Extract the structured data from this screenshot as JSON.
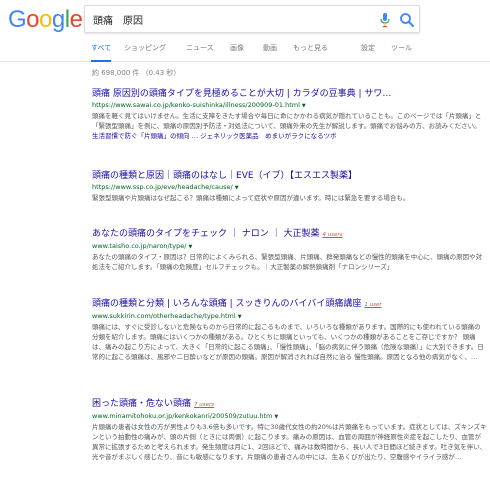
{
  "logo": {
    "text": "Google",
    "letters": [
      {
        "ch": "G",
        "color": "#4285F4"
      },
      {
        "ch": "o",
        "color": "#EA4335"
      },
      {
        "ch": "o",
        "color": "#FBBC05"
      },
      {
        "ch": "g",
        "color": "#4285F4"
      },
      {
        "ch": "l",
        "color": "#34A853"
      },
      {
        "ch": "e",
        "color": "#EA4335"
      }
    ]
  },
  "search": {
    "query": "頭痛　原因",
    "mic_icon": "mic-icon",
    "search_icon": "search-icon"
  },
  "tabs": [
    {
      "label": "すべて"
    },
    {
      "label": "ショッピング"
    },
    {
      "label": "ニュース"
    },
    {
      "label": "画像"
    },
    {
      "label": "動画"
    },
    {
      "label": "もっと見る"
    },
    {
      "label": "設定"
    },
    {
      "label": "ツール"
    }
  ],
  "stats": "約 698,000 件 （0.43 秒）",
  "results": [
    {
      "title": "頭痛 原因別の頭痛タイプを見極めることが大切 | カラダの豆事典 | サワ…",
      "url": "https://www.sawai.co.jp/kenko-suishinka/illness/200909-01.html",
      "users": "",
      "snippet": "頭痛を軽く見てはいけません。生活に支障をきたす場合や毎日に命にかかわる病気が隠れていることも。このページでは「片頭痛」と「緊張型頭痛」を例に、頭痛の原因別予防法・対処法について、頭痛外来の先生が解説します。頭痛でお悩みの方、お読みください。",
      "sublinks": "生活習慣で防ぐ「片頭痛」の傾向 … ジェネリック医薬品　めまいがラクになるツボ"
    },
    {
      "title": "頭痛の種類と原因｜頭痛のはなし｜EVE（イブ）【エスエス製薬】",
      "url": "https://www.ssp.co.jp/eve/headache/cause/",
      "users": "",
      "snippet": "緊張型頭痛や片頭痛はなぜ起こる？頭痛は種類によって症状や原因が違います。時には緊急を要する場合も。",
      "sublinks": ""
    },
    {
      "title": "あなたの頭痛のタイプをチェック ｜ ナロン ｜ 大正製薬",
      "url": "www.taisho.co.jp/naron/type/",
      "users": "4 users",
      "snippet": "あなたの頭痛のタイプ・原因は？日常的によくみられる、緊張型頭痛、片頭痛、群発頭痛などの慢性的頭痛を中心に、頭痛の原因や対処法をご紹介します。「頭痛の危険度」セルフチェックも。｜大正製薬の解熱鎮痛剤「ナロンシリーズ」",
      "sublinks": ""
    },
    {
      "title": "頭痛の種類と分類 | いろんな頭痛 | スッきりんのバイバイ頭痛講座",
      "url": "www.sukkirin.com/otherheadache/type.html",
      "users": "1 user",
      "snippet": "頭痛には、すぐに受診しないと危険なものから日常的に起こるものまで、いろいろな種類があります。国際的にも使われている頭痛の分類を紹介します。頭痛にはいくつかの種類がある。ひとくちに頭痛といっても、いくつかの種類があることをご存じですか？ 頭痛は、痛みの起こり方によって、大きく「日常的に起こる頭痛」、「慢性頭痛」、「脳の病気に伴う頭痛（危険な頭痛）」に大別できます。日常的に起こる頭痛は、風邪や二日酔いなどが原因の頭痛。原因が解消されれば自然に治る 慢性頭痛。原因となる他の病気がなく、…",
      "sublinks": ""
    },
    {
      "title": "困った頭痛・危ない頭痛",
      "url": "www.minamitohoku.or.jp/kenkokanri/200509/zutuu.htm",
      "users": "7 users",
      "snippet": "片頭痛の患者は女性の方が男性よりも3.6倍も多いです。特に30歳代女性の約20%は片頭痛をもっています。症状としては、ズキンズキンという拍動性の痛みが、頭の片側（ときには両側）に起こります。痛みの原因は、血管の周囲が神経原性炎症を起こしたり、血管が異常に拡張するためと考えられます。発生頻度は月に1、2回ほどで、痛みは数時間から、長い人で3日間ほど続きます。吐き気を伴い、光や音がまぶしく感じたり、音にも敏感になります。片頭痛の患者さんの中には、生あくびが出たり、空腹感やイライラ感が…",
      "sublinks": ""
    }
  ]
}
